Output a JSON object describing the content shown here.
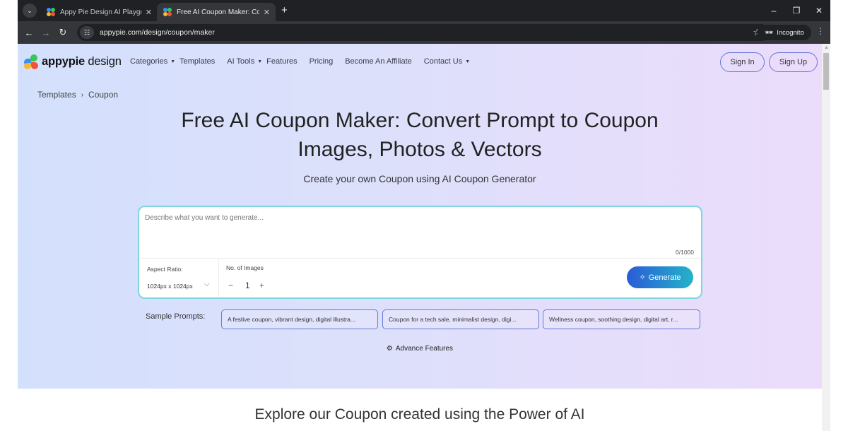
{
  "browser": {
    "tabs": [
      {
        "title": "Appy Pie Design AI Playground",
        "active": false
      },
      {
        "title": "Free AI Coupon Maker: Convert",
        "active": true
      }
    ],
    "url": "appypie.com/design/coupon/maker",
    "incognito_label": "Incognito",
    "icons": {
      "tab_search": "chevron-down-icon",
      "close": "close-icon",
      "new_tab": "plus-icon",
      "back": "arrow-left-icon",
      "forward": "arrow-right-icon",
      "reload": "reload-icon",
      "site_info": "tune-icon",
      "bookmark": "star-icon",
      "incognito": "incognito-icon",
      "menu": "kebab-icon"
    }
  },
  "header": {
    "logo_bold": "appypie",
    "logo_light": " design",
    "nav": [
      {
        "label": "Categories",
        "dropdown": true
      },
      {
        "label": "Templates",
        "dropdown": false
      },
      {
        "label": "AI Tools",
        "dropdown": true
      },
      {
        "label": "Features",
        "dropdown": false
      },
      {
        "label": "Pricing",
        "dropdown": false
      },
      {
        "label": "Become An Affiliate",
        "dropdown": false
      },
      {
        "label": "Contact Us",
        "dropdown": true
      }
    ],
    "sign_in": "Sign In",
    "sign_up": "Sign Up"
  },
  "breadcrumb": {
    "items": [
      "Templates",
      "Coupon"
    ],
    "separator": "›"
  },
  "hero": {
    "title_line1": "Free AI Coupon Maker: Convert Prompt to Coupon",
    "title_line2": "Images, Photos & Vectors",
    "subtitle": "Create your own Coupon using AI Coupon Generator"
  },
  "prompt_card": {
    "placeholder": "Describe what you want to generate...",
    "value": "",
    "counter": "0/1000",
    "aspect_label": "Aspect Ratio:",
    "aspect_value": "1024px x 1024px",
    "num_images_label": "No. of Images",
    "num_images_value": "1",
    "minus": "−",
    "plus": "+",
    "generate_label": "Generate"
  },
  "sample_prompts": {
    "label": "Sample Prompts:",
    "items": [
      "A festive coupon, vibrant design, digital illustra...",
      "Coupon for a tech sale, minimalist design, digi...",
      "Wellness coupon, soothing design, digital art, r..."
    ]
  },
  "advance_features": "Advance Features",
  "explore_heading": "Explore our Coupon created using the Power of AI",
  "colors": {
    "accent_blue": "#2a5bd7",
    "accent_teal": "#24b3c8",
    "card_border": "#7fd6df",
    "chip_border": "#6677d9"
  }
}
